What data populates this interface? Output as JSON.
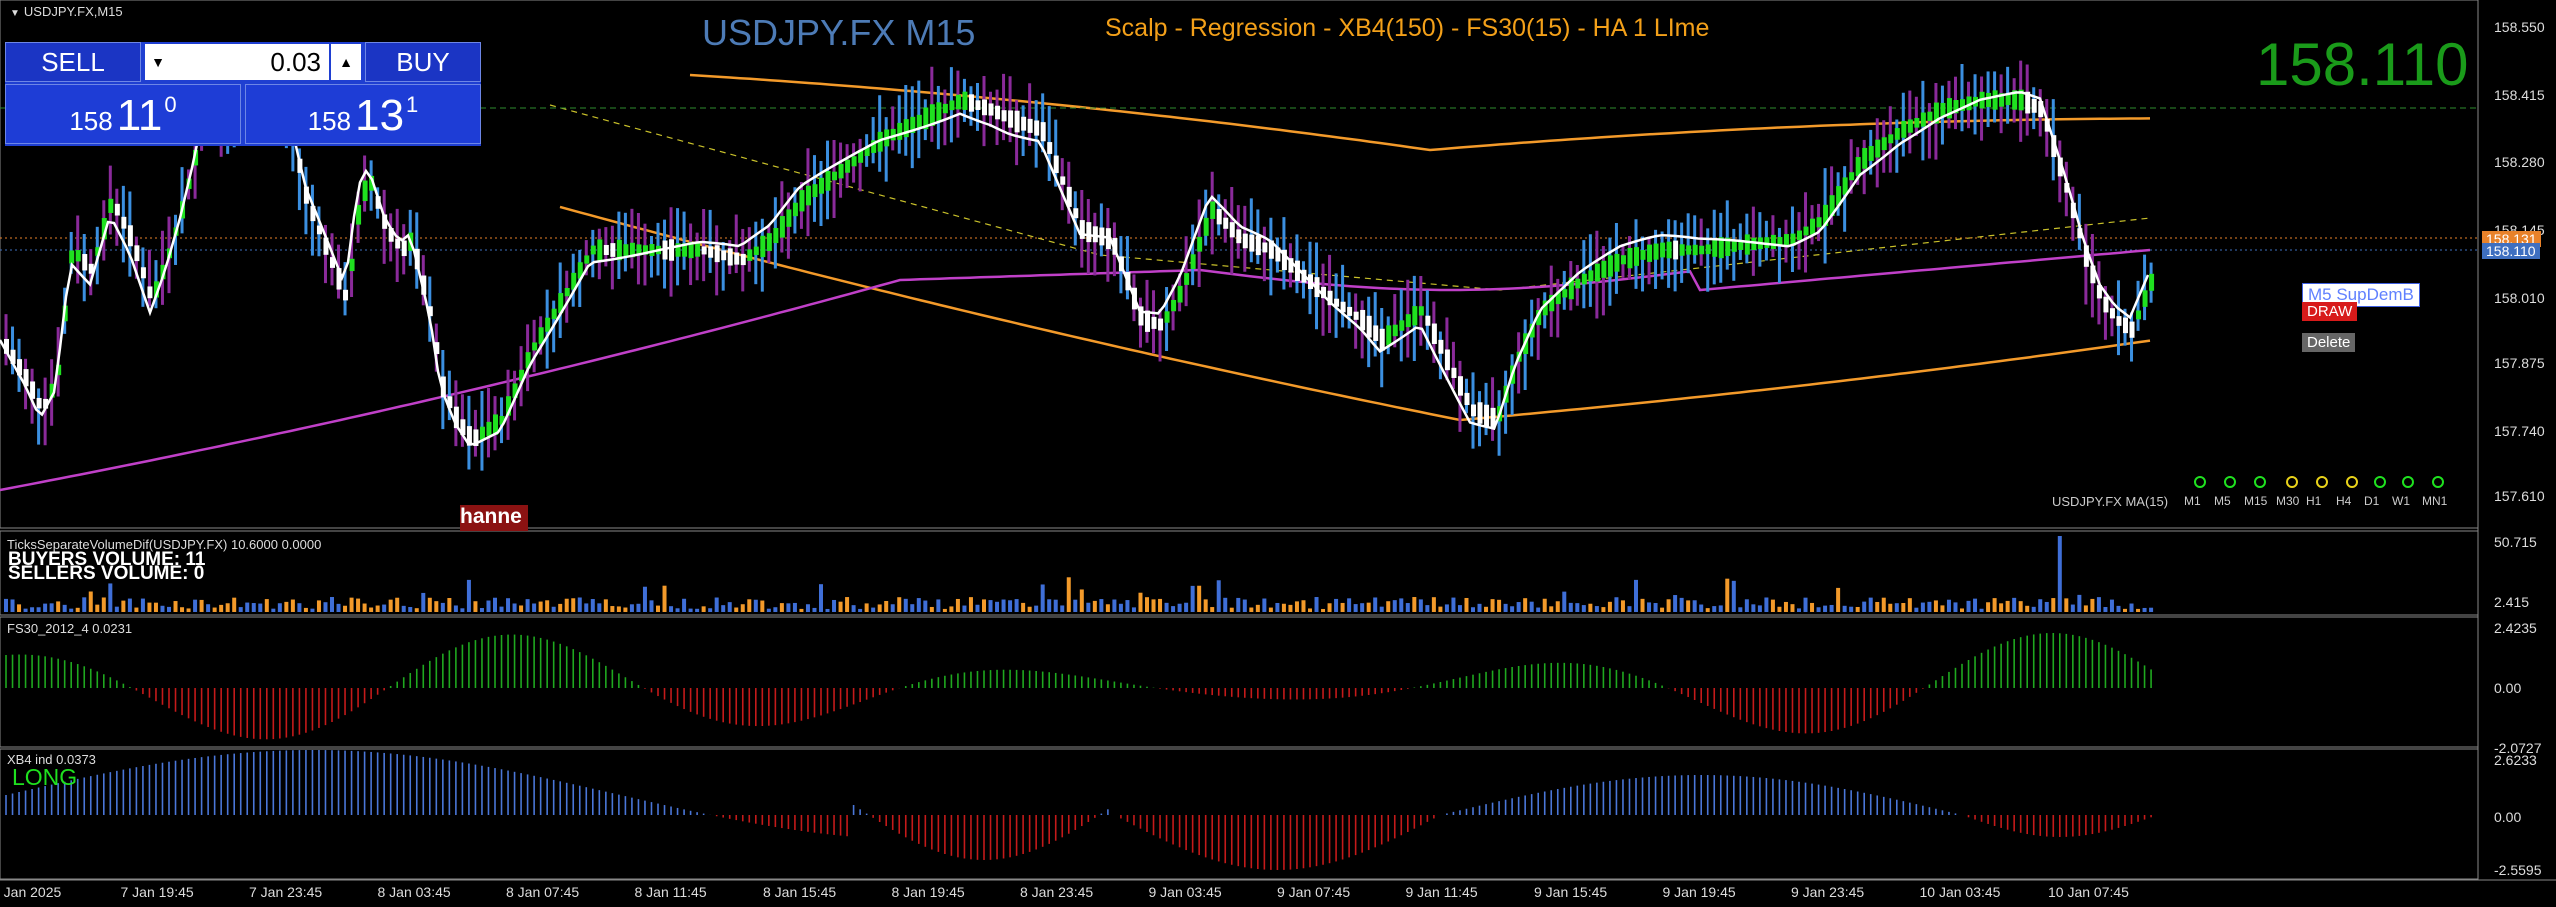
{
  "chart_window": {
    "symbol_label": "USDJPY.FX,M15",
    "title_symbol": "USDJPY.FX M15",
    "title_indicator": "Scalp - Regression - XB4(150) - FS30(15) - HA  1 LIme",
    "big_price": "158.110",
    "colors": {
      "bull": "#1fe11f",
      "bear": "#ffffff",
      "wick_up": "#3b8fe0",
      "wick_dn": "#8a2a9a",
      "ma": "#c040c8",
      "channel": "#f39a2a",
      "fast": "#ffffff"
    }
  },
  "trade_panel": {
    "sell_label": "SELL",
    "buy_label": "BUY",
    "lot": "0.03",
    "lot_down": "▼",
    "lot_up": "▲",
    "bid": {
      "big": "158",
      "pips": "11",
      "frac": "0"
    },
    "ask": {
      "big": "158",
      "pips": "13",
      "frac": "1"
    }
  },
  "price_axis": [
    "158.550",
    "158.415",
    "158.280",
    "158.145",
    "158.010",
    "157.875",
    "157.740",
    "157.610"
  ],
  "price_tags": {
    "ask": "158.131",
    "bid": "158.110"
  },
  "time_axis": [
    "7 Jan 2025",
    "7 Jan 19:45",
    "7 Jan 23:45",
    "8 Jan 03:45",
    "8 Jan 07:45",
    "8 Jan 11:45",
    "8 Jan 15:45",
    "8 Jan 19:45",
    "8 Jan 23:45",
    "9 Jan 03:45",
    "9 Jan 07:45",
    "9 Jan 11:45",
    "9 Jan 15:45",
    "9 Jan 19:45",
    "9 Jan 23:45",
    "10 Jan 03:45",
    "10 Jan 07:45"
  ],
  "objects": {
    "ma_label": "USDJPY.FX MA(15)",
    "support_label": "M5 SupDemB",
    "draw_label": "DRAW",
    "delete_label": "Delete",
    "hann_label": "hanne"
  },
  "timeframes": [
    {
      "label": "M1",
      "color": "#1fe11f"
    },
    {
      "label": "M5",
      "color": "#1fe11f"
    },
    {
      "label": "M15",
      "color": "#1fe11f"
    },
    {
      "label": "M30",
      "color": "#e8d21a"
    },
    {
      "label": "H1",
      "color": "#e8d21a"
    },
    {
      "label": "H4",
      "color": "#e8d21a"
    },
    {
      "label": "D1",
      "color": "#1fe11f"
    },
    {
      "label": "W1",
      "color": "#1fe11f"
    },
    {
      "label": "MN1",
      "color": "#1fe11f"
    }
  ],
  "volume_panel": {
    "title": "TicksSeparateVolumeDif(USDJPY.FX) 10.6000 0.0000",
    "buyers": "BUYERS VOLUME: 11",
    "sellers": "SELLERS VOLUME: 0",
    "axis": [
      "50.715",
      "2.415"
    ]
  },
  "fs30_panel": {
    "title": "FS30_2012_4 0.0231",
    "axis": [
      "2.4235",
      "0.00",
      "-2.0727"
    ]
  },
  "xb4_panel": {
    "title": "XB4 ind 0.0373",
    "signal": "LONG",
    "axis": [
      "2.6233",
      "0.00",
      "-2.5595"
    ]
  }
}
